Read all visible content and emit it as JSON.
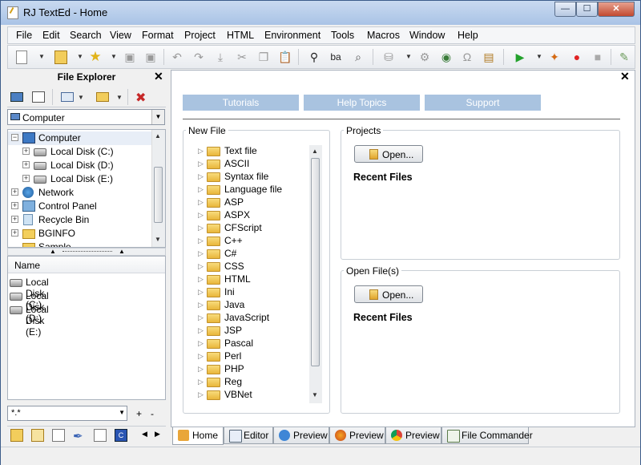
{
  "window": {
    "title": "RJ TextEd - Home",
    "min": "—",
    "max": "☐",
    "close": "✕"
  },
  "menu": [
    "File",
    "Edit",
    "Search",
    "View",
    "Format",
    "Project",
    "HTML",
    "Environment",
    "Tools",
    "Macros",
    "Window",
    "Help"
  ],
  "explorer": {
    "title": "File Explorer",
    "close": "✕",
    "drive_select": "Computer",
    "tree": [
      {
        "label": "Computer",
        "icon": "computer-icon"
      },
      {
        "label": "Local Disk (C:)",
        "icon": "drive-icon"
      },
      {
        "label": "Local Disk (D:)",
        "icon": "drive-icon"
      },
      {
        "label": "Local Disk (E:)",
        "icon": "drive-icon"
      },
      {
        "label": "Network",
        "icon": "network-icon"
      },
      {
        "label": "Control Panel",
        "icon": "control-panel-icon"
      },
      {
        "label": "Recycle Bin",
        "icon": "recycle-bin-icon"
      },
      {
        "label": "BGINFO",
        "icon": "folder-icon"
      },
      {
        "label": "Sample",
        "icon": "folder-icon"
      }
    ],
    "list_header": "Name",
    "list": [
      "Local Disk (C:)",
      "Local Disk (D:)",
      "Local Disk (E:)"
    ],
    "filter": "*.*",
    "plus": "+",
    "minus": "-"
  },
  "home": {
    "close": "✕",
    "buttons": [
      "Tutorials",
      "Help Topics",
      "Support"
    ],
    "new_file_label": "New File",
    "new_file_items": [
      "Text file",
      "ASCII",
      "Syntax file",
      "Language file",
      "ASP",
      "ASPX",
      "CFScript",
      "C++",
      "C#",
      "CSS",
      "HTML",
      "Ini",
      "Java",
      "JavaScript",
      "JSP",
      "Pascal",
      "Perl",
      "PHP",
      "Reg",
      "VBNet"
    ],
    "projects_label": "Projects",
    "open_files_label": "Open File(s)",
    "open_label": "Open...",
    "recent_files": "Recent Files"
  },
  "tabs": [
    "Home",
    "Editor",
    "Preview",
    "Preview",
    "Preview",
    "File Commander"
  ]
}
